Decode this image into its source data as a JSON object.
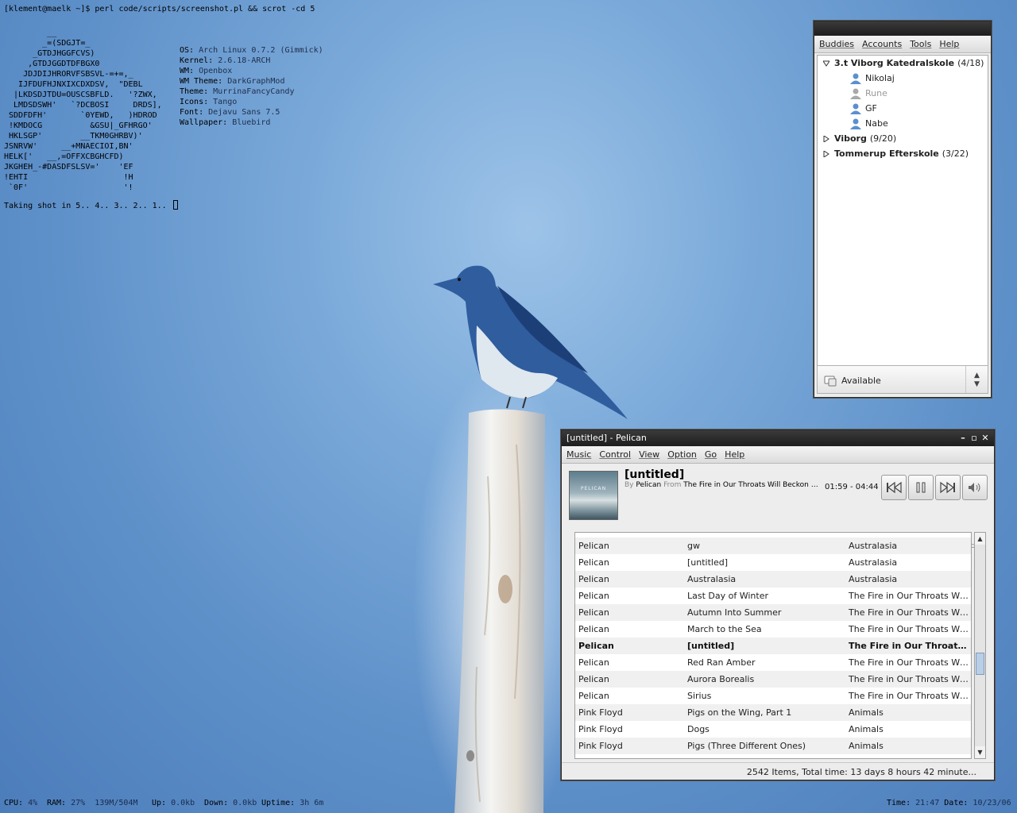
{
  "terminal": {
    "prompt": "[klement@maelk ~]$ perl code/scripts/screenshot.pl && scrot -cd 5",
    "ascii_art": "         __\n        _=(SDGJT=_\n      _GTDJHGGFCVS)\n     ,GTDJGGDTDFBGX0\n    JDJDIJHRORVFSBSVL-=+=,_\n   IJFDUFHJNXIXCDXDSV,  \"DEBL\n  |LKDSDJTDU=OUSCSBFLD.   '?ZWX,\n  LMDSDSWH'   `?DCBOSI     DRDS],\n SDDFDFH'       `0YEWD,   )HDROD\n !KMDOCG          &GSU|_GFHRGO'\n HKLSGP'        __TKM0GHRBV)'\nJSNRVW'     __+MNAECIOI,BN'\nHELK['   __,=OFFXCBGHCFD)\nJKGHEH_-#DASDFSLSV='    'EF\n!EHTI                    !H\n `0F'                    '!",
    "countdown": "Taking shot in 5.. 4.. 3.. 2.. 1.. ",
    "sysinfo": [
      {
        "label": "OS:",
        "value": "Arch Linux 0.7.2 (Gimmick)"
      },
      {
        "label": "Kernel:",
        "value": "2.6.18-ARCH"
      },
      {
        "label": "WM:",
        "value": "Openbox"
      },
      {
        "label": "WM Theme:",
        "value": "DarkGraphMod"
      },
      {
        "label": "Theme:",
        "value": "MurrinaFancyCandy"
      },
      {
        "label": "Icons:",
        "value": "Tango"
      },
      {
        "label": "Font:",
        "value": "Dejavu Sans 7.5"
      },
      {
        "label": "Wallpaper:",
        "value": "Bluebird"
      }
    ]
  },
  "statusbar": {
    "cpu_label": "CPU:",
    "cpu": "4%",
    "ram_label": "RAM:",
    "ram": "27%",
    "ram_detail": "139M/504M",
    "up_label": "Up:",
    "up": "0.0kb",
    "down_label": "Down:",
    "down": "0.0kb",
    "uptime_label": "Uptime:",
    "uptime": "3h 6m",
    "time_label": "Time:",
    "time": "21:47",
    "date_label": "Date:",
    "date": "10/23/06"
  },
  "buddy": {
    "menu": [
      "Buddies",
      "Accounts",
      "Tools",
      "Help"
    ],
    "groups": [
      {
        "name": "3.t Viborg Katedralskole",
        "count": "(4/18)",
        "expanded": true,
        "members": [
          {
            "name": "Nikolaj",
            "idle": false
          },
          {
            "name": "Rune",
            "idle": true
          },
          {
            "name": "GF",
            "idle": false
          },
          {
            "name": "Nabe",
            "idle": false
          }
        ]
      },
      {
        "name": "Viborg",
        "count": "(9/20)",
        "expanded": false,
        "members": []
      },
      {
        "name": "Tommerup Efterskole",
        "count": "(3/22)",
        "expanded": false,
        "members": []
      }
    ],
    "status": "Available"
  },
  "pelican": {
    "title": "[untitled] - Pelican",
    "menu": [
      "Music",
      "Control",
      "View",
      "Option",
      "Go",
      "Help"
    ],
    "album_art_text": "PELICAN",
    "now_playing": {
      "title": "[untitled]",
      "by_label": "By",
      "artist": "Pelican",
      "from_label": "From",
      "album": "The Fire in Our Throats Will Beckon the T...",
      "time": "01:59 - 04:44",
      "progress": 0.42
    },
    "scroll_position": 0.6,
    "tracks": [
      {
        "artist": "Pelican",
        "title": "gw",
        "album": "Australasia"
      },
      {
        "artist": "Pelican",
        "title": "[untitled]",
        "album": "Australasia"
      },
      {
        "artist": "Pelican",
        "title": "Australasia",
        "album": "Australasia"
      },
      {
        "artist": "Pelican",
        "title": "Last Day of Winter",
        "album": "The Fire in Our Throats Will B..."
      },
      {
        "artist": "Pelican",
        "title": "Autumn Into Summer",
        "album": "The Fire in Our Throats Will B..."
      },
      {
        "artist": "Pelican",
        "title": "March to the Sea",
        "album": "The Fire in Our Throats Will B..."
      },
      {
        "artist": "Pelican",
        "title": "[untitled]",
        "album": "The Fire in Our Throats ...",
        "playing": true
      },
      {
        "artist": "Pelican",
        "title": "Red Ran Amber",
        "album": "The Fire in Our Throats Will B..."
      },
      {
        "artist": "Pelican",
        "title": "Aurora Borealis",
        "album": "The Fire in Our Throats Will B..."
      },
      {
        "artist": "Pelican",
        "title": "Sirius",
        "album": "The Fire in Our Throats Will B..."
      },
      {
        "artist": "Pink Floyd",
        "title": "Pigs on the Wing, Part 1",
        "album": "Animals"
      },
      {
        "artist": "Pink Floyd",
        "title": "Dogs",
        "album": "Animals"
      },
      {
        "artist": "Pink Floyd",
        "title": "Pigs (Three Different Ones)",
        "album": "Animals"
      }
    ],
    "status": "2542 Items,  Total time: 13 days 8 hours 42 minute..."
  }
}
